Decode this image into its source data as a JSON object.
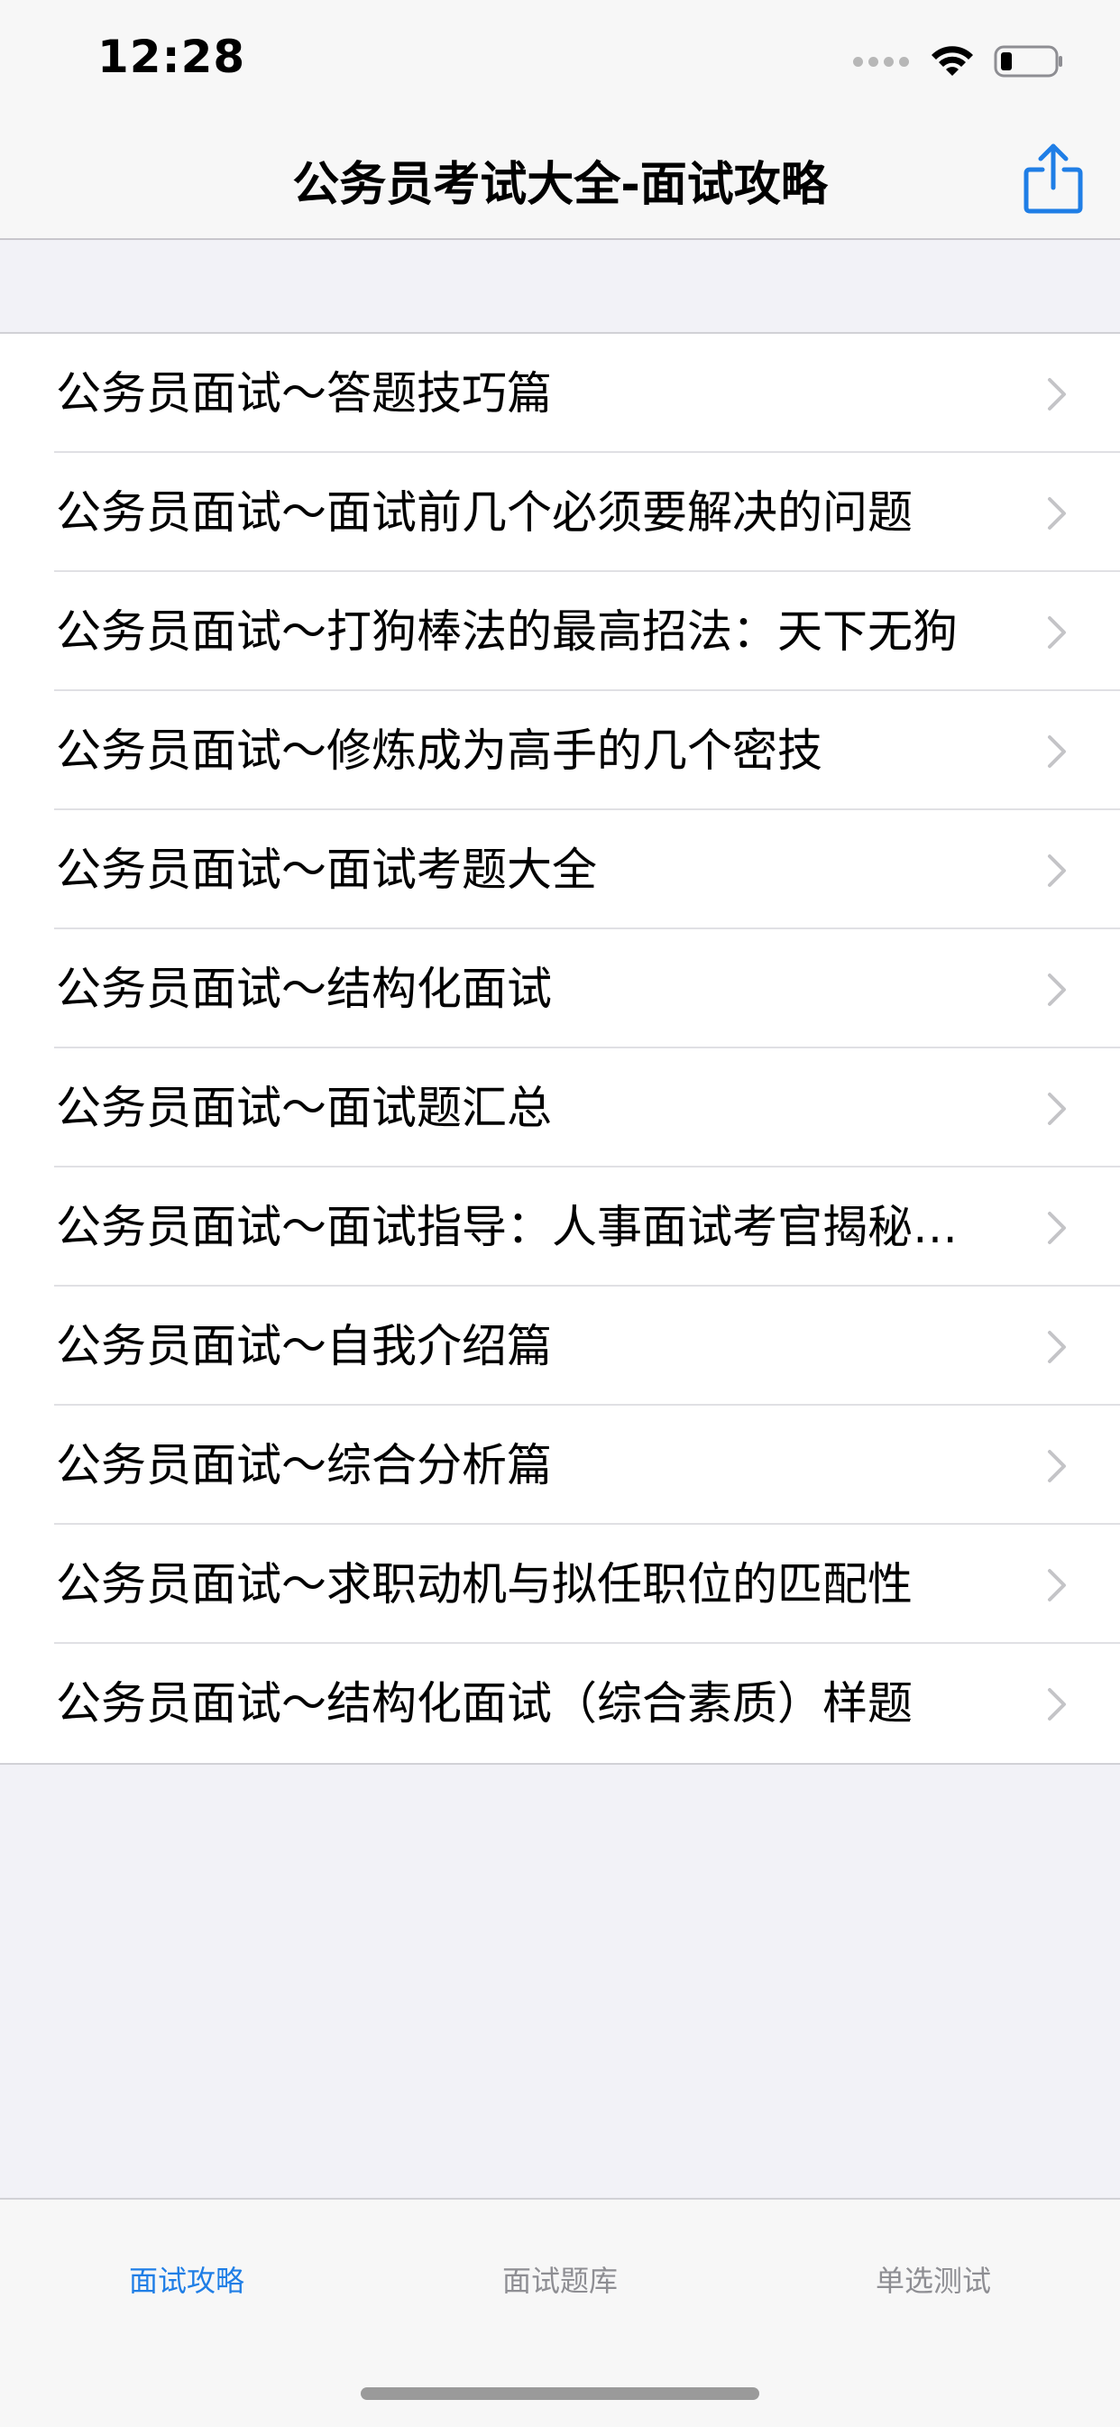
{
  "status_bar": {
    "time": "12:28",
    "icons": [
      "signal-dots-icon",
      "wifi-icon",
      "battery-icon"
    ]
  },
  "nav": {
    "title": "公务员考试大全-面试攻略",
    "share_icon": "share-icon"
  },
  "list": {
    "items": [
      {
        "label": "公务员面试～答题技巧篇"
      },
      {
        "label": "公务员面试～面试前几个必须要解决的问题"
      },
      {
        "label": "公务员面试～打狗棒法的最高招法：天下无狗"
      },
      {
        "label": "公务员面试～修炼成为高手的几个密技"
      },
      {
        "label": "公务员面试～面试考题大全"
      },
      {
        "label": "公务员面试～结构化面试"
      },
      {
        "label": "公务员面试～面试题汇总"
      },
      {
        "label": "公务员面试～面试指导：人事面试考官揭秘…"
      },
      {
        "label": "公务员面试～自我介绍篇"
      },
      {
        "label": "公务员面试～综合分析篇"
      },
      {
        "label": "公务员面试～求职动机与拟任职位的匹配性"
      },
      {
        "label": "公务员面试～结构化面试（综合素质）样题"
      }
    ]
  },
  "tabs": [
    {
      "label": "面试攻略",
      "active": true
    },
    {
      "label": "面试题库",
      "active": false
    },
    {
      "label": "单选测试",
      "active": false
    }
  ],
  "colors": {
    "accent": "#1f7ee6",
    "inactive_tab": "#8e8e93",
    "background": "#f2f2f7"
  }
}
